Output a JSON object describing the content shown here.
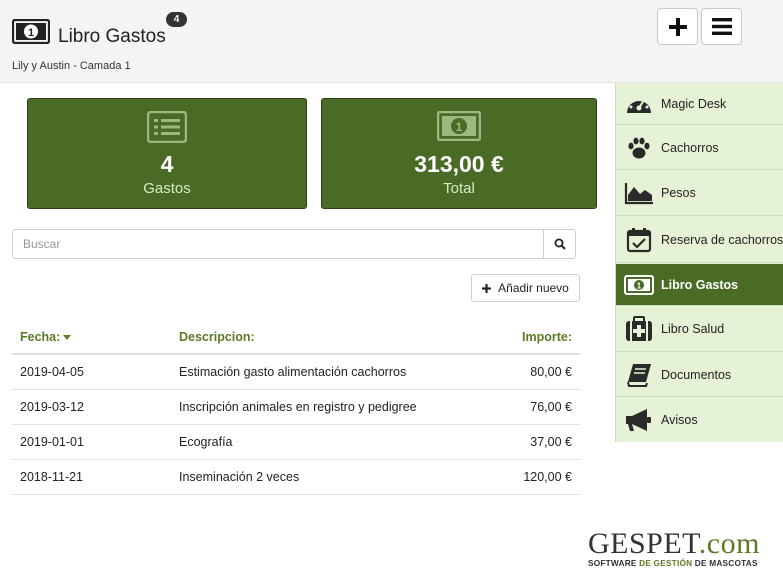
{
  "header": {
    "title": "Libro Gastos",
    "badge": "4",
    "subtitle": "Lily y Austin - Camada 1",
    "icon": "money-bill-icon"
  },
  "cards": [
    {
      "value": "4",
      "label": "Gastos",
      "icon": "list-icon"
    },
    {
      "value": "313,00 €",
      "label": "Total",
      "icon": "money-bill-icon"
    }
  ],
  "search": {
    "placeholder": "Buscar",
    "value": ""
  },
  "add_button": {
    "label": "Añadir nuevo"
  },
  "table": {
    "headers": [
      "Fecha:",
      "Descripcion:",
      "Importe:"
    ],
    "rows": [
      {
        "fecha": "2019-04-05",
        "descripcion": "Estimación gasto alimentación cachorros",
        "importe": "80,00 €"
      },
      {
        "fecha": "2019-03-12",
        "descripcion": "Inscripción animales en registro y pedigree",
        "importe": "76,00 €"
      },
      {
        "fecha": "2019-01-01",
        "descripcion": "Ecografía",
        "importe": "37,00 €"
      },
      {
        "fecha": "2018-11-21",
        "descripcion": "Inseminación 2 veces",
        "importe": "120,00 €"
      }
    ]
  },
  "sidebar": {
    "items": [
      {
        "label": "Magic Desk",
        "icon": "dashboard-icon",
        "active": false
      },
      {
        "label": "Cachorros",
        "icon": "paw-icon",
        "active": false
      },
      {
        "label": "Pesos",
        "icon": "area-chart-icon",
        "active": false
      },
      {
        "label": "Reserva de cachorros",
        "icon": "calendar-check-icon",
        "active": false
      },
      {
        "label": "Libro Gastos",
        "icon": "money-bill-icon",
        "active": true
      },
      {
        "label": "Libro Salud",
        "icon": "medkit-icon",
        "active": false
      },
      {
        "label": "Documentos",
        "icon": "book-icon",
        "active": false
      },
      {
        "label": "Avisos",
        "icon": "megaphone-icon",
        "active": false
      }
    ]
  },
  "logo": {
    "main": "GESPET",
    "suffix": ".com",
    "tagline_a": "SOFTWARE ",
    "tagline_b": "DE GESTIÓN",
    "tagline_c": " DE MASCOTAS"
  },
  "colors": {
    "accent": "#4a6b25",
    "sidebar_bg": "#e6f2d6",
    "header_text": "#5a7a26"
  }
}
